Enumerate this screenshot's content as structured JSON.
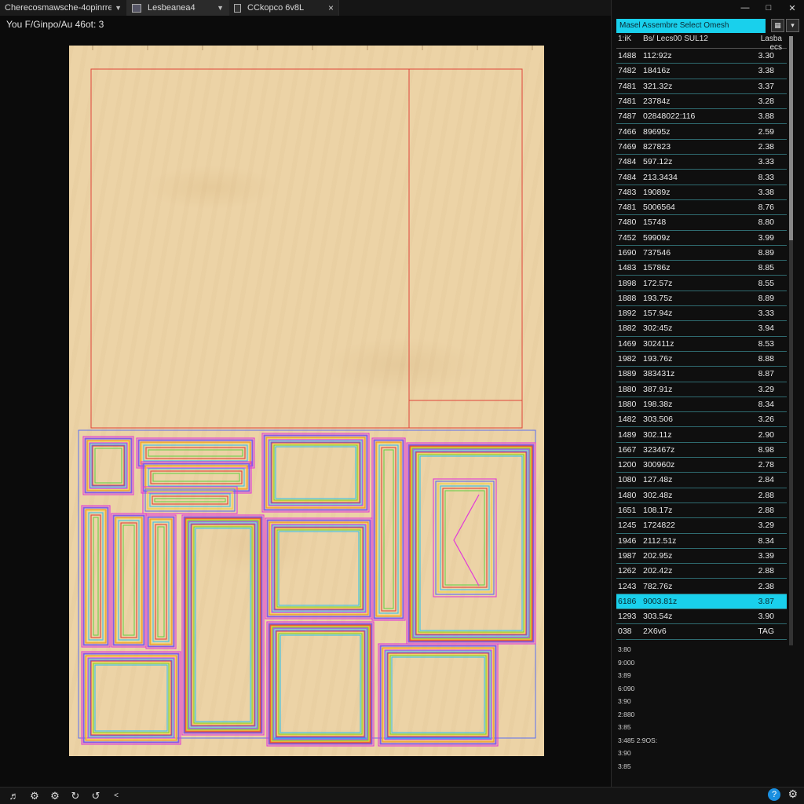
{
  "tabs": [
    {
      "label": "Cherecosmawsche-4opinrrer"
    },
    {
      "label": "Lesbeanea4"
    },
    {
      "label": "CCkopco 6v8L"
    }
  ],
  "subtitle": "You F/Ginpo/Au 46ot: 3",
  "panel": {
    "header": "Masel Assembre Select Omesh",
    "columns": [
      "1:iK",
      "Bs/ Lecs00 SUL12",
      "Lasba ecs"
    ],
    "rows": [
      [
        "1488",
        "112:92z",
        "3.30"
      ],
      [
        "7482",
        "18416z",
        "3.38"
      ],
      [
        "7481",
        "321.32z",
        "3.37"
      ],
      [
        "7481",
        "23784z",
        "3.28"
      ],
      [
        "7487",
        "02848022:116",
        "3.88"
      ],
      [
        "7466",
        "89695z",
        "2.59"
      ],
      [
        "7469",
        "827823",
        "2.38"
      ],
      [
        "7484",
        "597.12z",
        "3.33"
      ],
      [
        "7484",
        "213.3434",
        "8.33"
      ],
      [
        "7483",
        "19089z",
        "3.38"
      ],
      [
        "7481",
        "5006564",
        "8.76"
      ],
      [
        "7480",
        "15748",
        "8.80"
      ],
      [
        "7452",
        "59909z",
        "3.99"
      ],
      [
        "1690",
        "737546",
        "8.89"
      ],
      [
        "1483",
        "15786z",
        "8.85"
      ],
      [
        "1898",
        "172.57z",
        "8.55"
      ],
      [
        "1888",
        "193.75z",
        "8.89"
      ],
      [
        "1892",
        "157.94z",
        "3.33"
      ],
      [
        "1882",
        "302:45z",
        "3.94"
      ],
      [
        "1469",
        "302411z",
        "8.53"
      ],
      [
        "1982",
        "193.76z",
        "8.88"
      ],
      [
        "1889",
        "383431z",
        "8.87"
      ],
      [
        "1880",
        "387.91z",
        "3.29"
      ],
      [
        "1880",
        "198.38z",
        "8.34"
      ],
      [
        "1482",
        "303.506",
        "3.26"
      ],
      [
        "1489",
        "302.11z",
        "2.90"
      ],
      [
        "1667",
        "323467z",
        "8.98"
      ],
      [
        "1200",
        "300960z",
        "2.78"
      ],
      [
        "1080",
        "127.48z",
        "2.84"
      ],
      [
        "1480",
        "302.48z",
        "2.88"
      ],
      [
        "1651",
        "108.17z",
        "2.88"
      ],
      [
        "1245",
        "1724822",
        "3.29"
      ],
      [
        "1946",
        "2112.51z",
        "8.34"
      ],
      [
        "1987",
        "202.95z",
        "3.39"
      ],
      [
        "1262",
        "202.42z",
        "2.88"
      ],
      [
        "1243",
        "782.76z",
        "2.38"
      ],
      [
        "6186",
        "9003.81z",
        "3.87"
      ],
      [
        "1293",
        "303.54z",
        "3.90"
      ],
      [
        "038",
        "2X6v6",
        "TAG"
      ]
    ],
    "selected_index": 36,
    "sublist": [
      "3:80",
      "9:000",
      "3:89",
      "6:090",
      "3:90",
      "2:880",
      "3:85",
      "3:485 2:9OS:",
      "3:90",
      "3:85"
    ]
  },
  "colors": {
    "accent": "#19d0ec",
    "board": "#ecd3a6"
  }
}
